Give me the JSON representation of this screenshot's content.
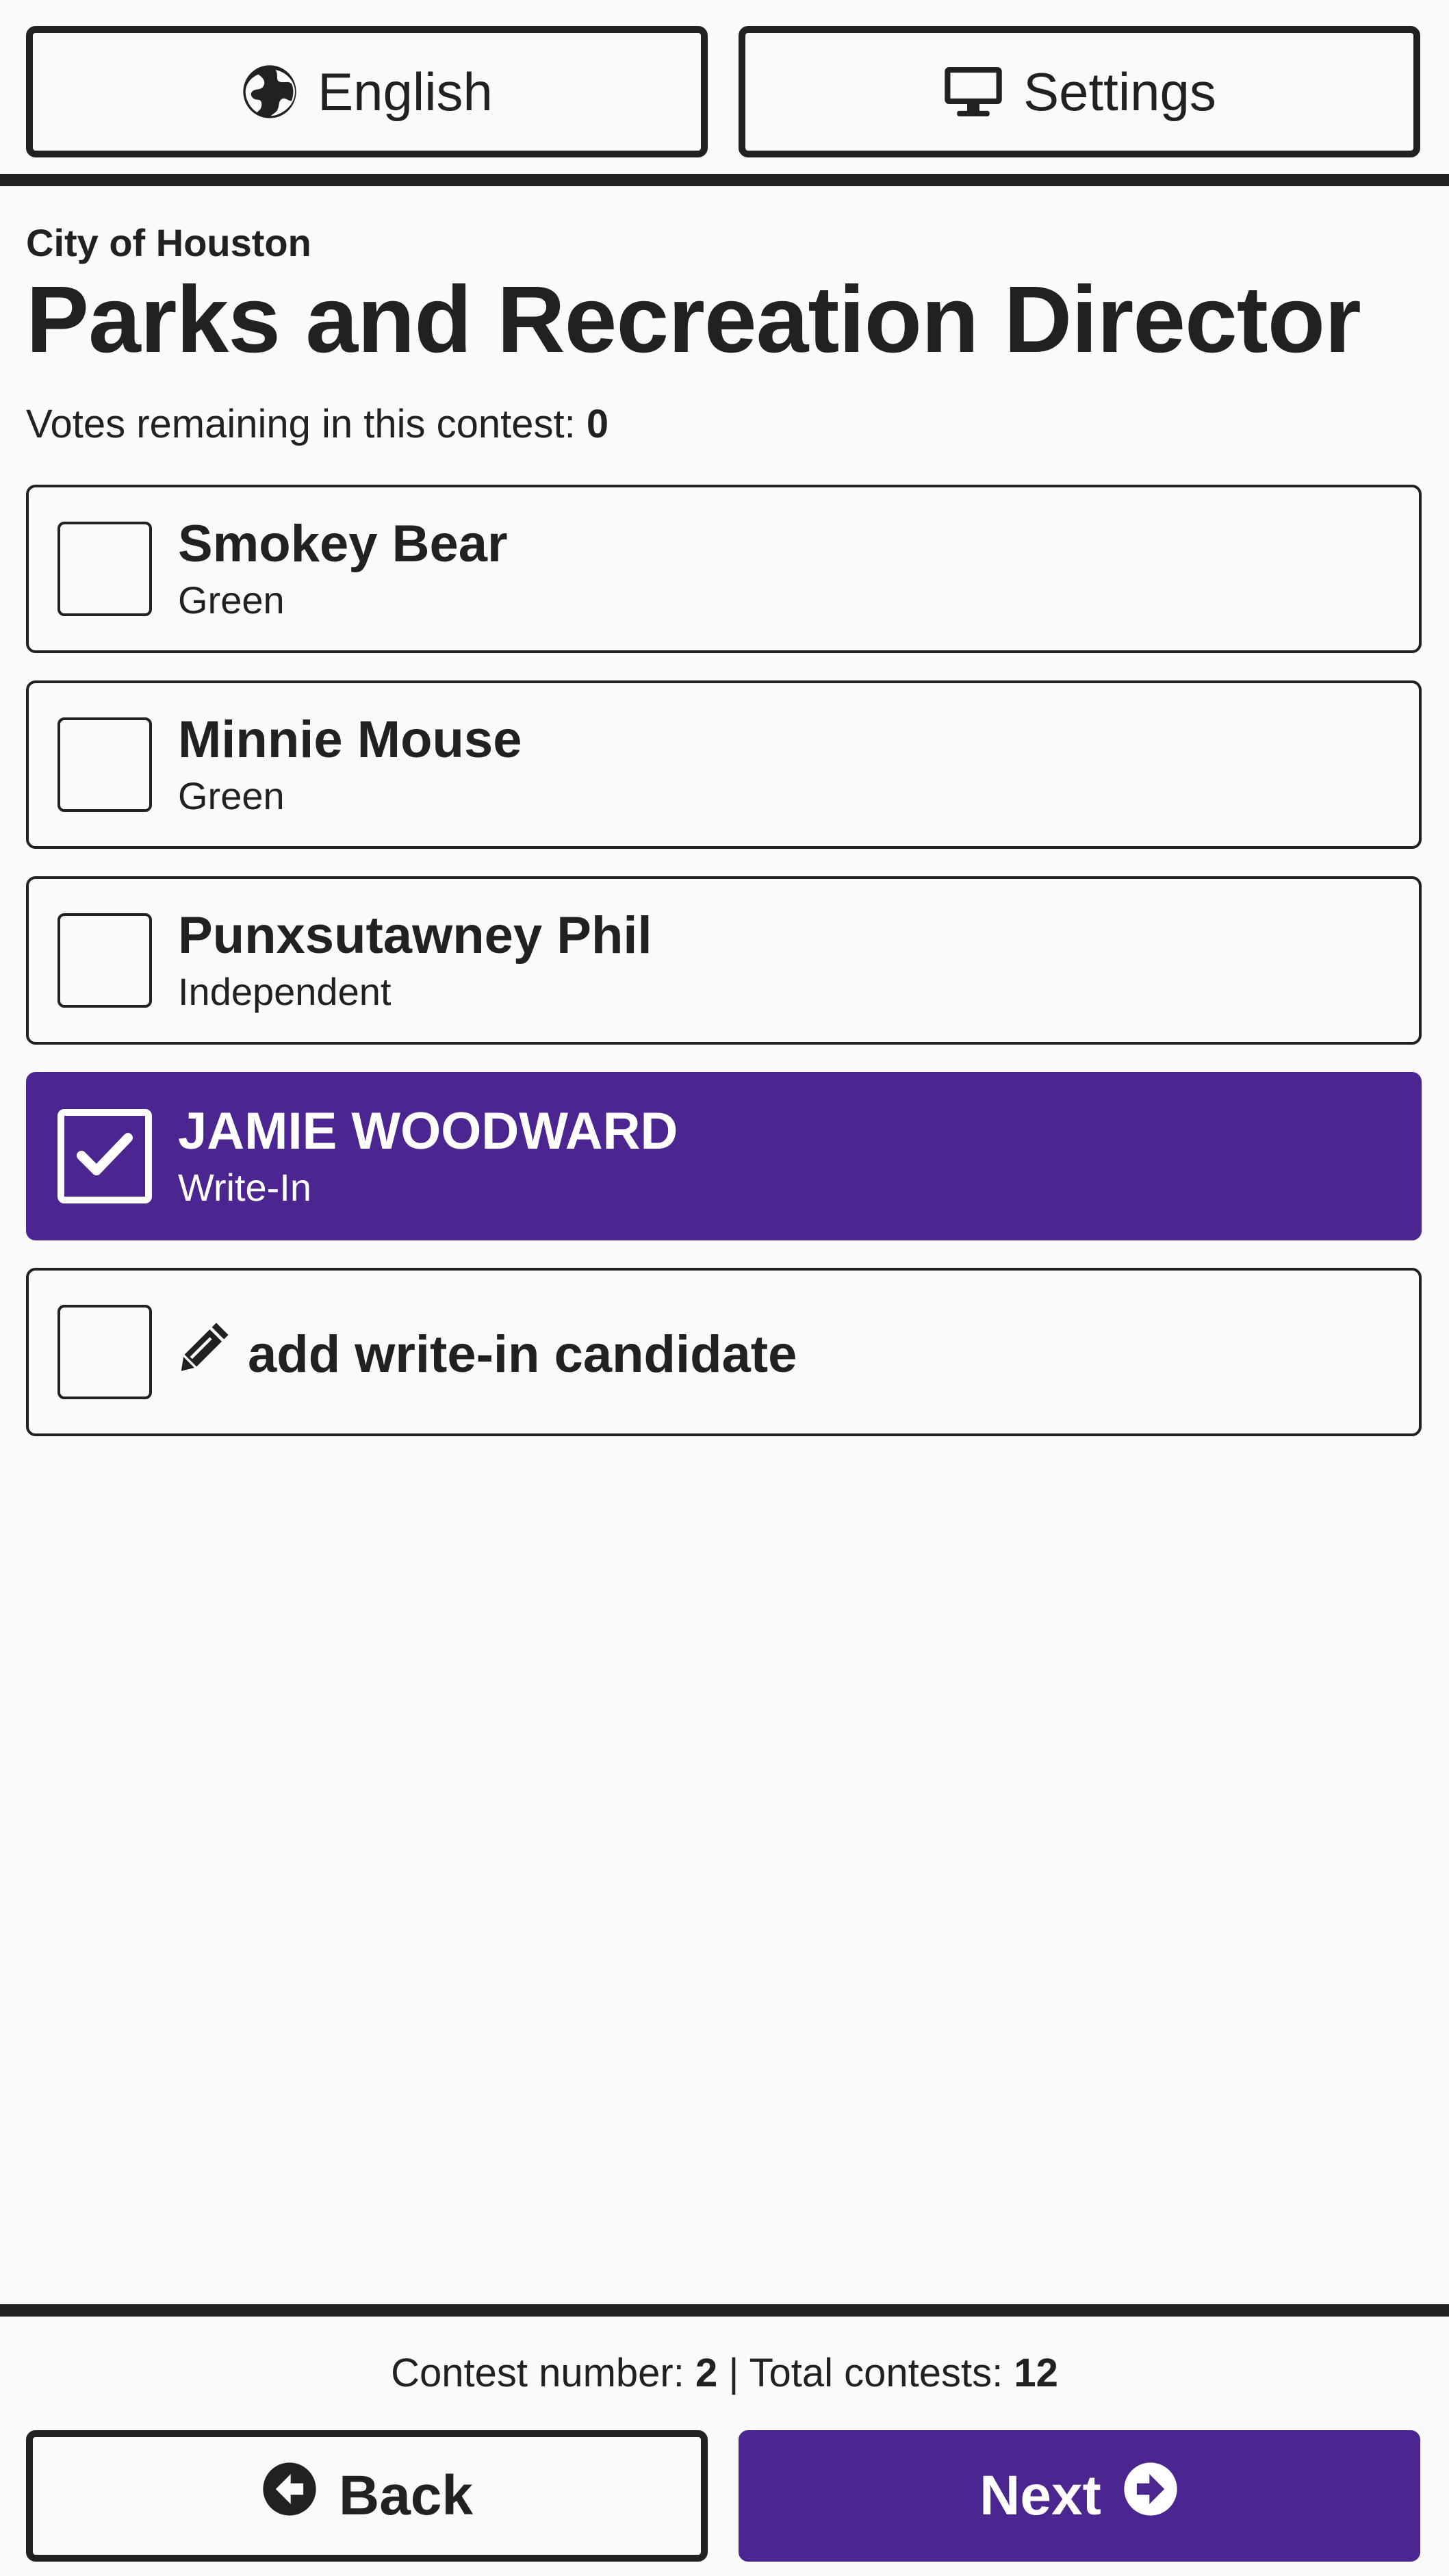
{
  "header": {
    "language_label": "English",
    "settings_label": "Settings"
  },
  "contest": {
    "organization": "City of Houston",
    "title": "Parks and Recreation Director",
    "votes_remaining_label": "Votes remaining in this contest:",
    "votes_remaining_value": "0"
  },
  "candidates": [
    {
      "name": "Smokey Bear",
      "party": "Green",
      "selected": false
    },
    {
      "name": "Minnie Mouse",
      "party": "Green",
      "selected": false
    },
    {
      "name": "Punxsutawney Phil",
      "party": "Independent",
      "selected": false
    },
    {
      "name": "JAMIE WOODWARD",
      "party": "Write-In",
      "selected": true
    }
  ],
  "write_in": {
    "label": "add write-in candidate"
  },
  "footer": {
    "contest_number_label": "Contest number:",
    "contest_number": "2",
    "separator": "|",
    "total_contests_label": "Total contests:",
    "total_contests": "12",
    "back_label": "Back",
    "next_label": "Next"
  },
  "colors": {
    "accent": "#4b2590",
    "text": "#212121",
    "background": "#fafafa"
  },
  "icons": {
    "language": "globe-icon",
    "settings": "monitor-icon",
    "write_in": "pencil-icon",
    "back": "arrow-left-circle-icon",
    "next": "arrow-right-circle-icon",
    "checked": "checkmark-icon"
  }
}
